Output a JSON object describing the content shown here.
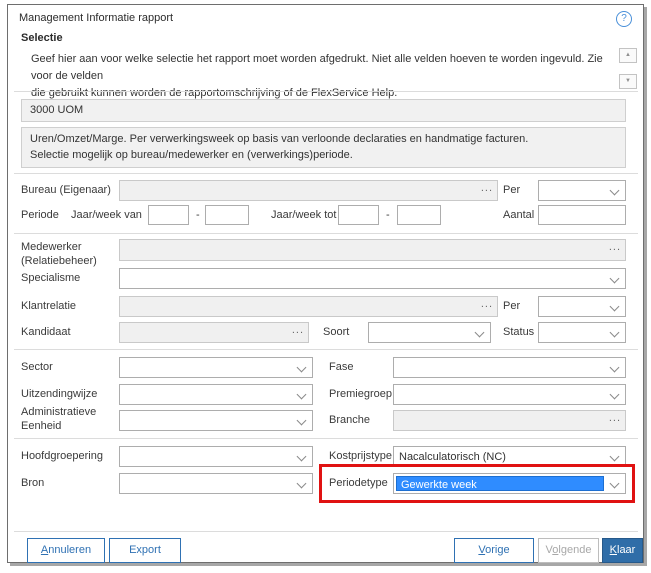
{
  "header": {
    "title": "Management Informatie rapport",
    "section_heading": "Selectie"
  },
  "icons": {
    "help": "?",
    "scroll_up": "▲",
    "scroll_down": "▼"
  },
  "intro": {
    "line1": "Geef hier aan voor welke selectie het rapport moet worden afgedrukt. Niet alle velden hoeven te worden ingevuld. Zie voor de velden",
    "line2": "die gebruikt kunnen worden de rapportomschrijving of de FlexService Help."
  },
  "report": {
    "code": "3000 UOM",
    "description_line1": "Uren/Omzet/Marge. Per verwerkingsweek op basis van verloonde declaraties en handmatige facturen.",
    "description_line2": "Selectie mogelijk op bureau/medewerker en (verwerkings)periode."
  },
  "form": {
    "bureau_label": "Bureau (Eigenaar)",
    "per_label": "Per",
    "periode_label": "Periode",
    "jaarweek_van_label": "Jaar/week van",
    "jaarweek_tot_label": "Jaar/week tot",
    "range_dash": "-",
    "aantal_label": "Aantal",
    "medewerker_label1": "Medewerker",
    "medewerker_label2": "(Relatiebeheer)",
    "specialisme_label": "Specialisme",
    "klantrelatie_label": "Klantrelatie",
    "kandidaat_label": "Kandidaat",
    "soort_label": "Soort",
    "status_label": "Status",
    "sector_label": "Sector",
    "fase_label": "Fase",
    "uitzendingwijze_label": "Uitzendingwijze",
    "premiegroep_label": "Premiegroep",
    "administratieve_label1": "Administratieve",
    "administratieve_label2": "Eenheid",
    "branche_label": "Branche",
    "hoofdgroepering_label": "Hoofdgroepering",
    "kostprijstype_label": "Kostprijstype",
    "kostprijstype_value": "Nacalculatorisch (NC)",
    "bron_label": "Bron",
    "periodetype_label": "Periodetype",
    "periodetype_value": "Gewerkte week",
    "ellipsis": "..."
  },
  "footer": {
    "annuleren_key": "A",
    "annuleren_rest": "nnuleren",
    "export_label": "Export",
    "vorige_key": "V",
    "vorige_rest": "orige",
    "volgende_pre": "V",
    "volgende_key": "o",
    "volgende_rest": "lgende",
    "klaar_key": "K",
    "klaar_rest": "laar"
  },
  "colors": {
    "accent_blue": "#2f71b3",
    "selection_blue": "#2f8cff",
    "annotation_red": "#e01212"
  }
}
